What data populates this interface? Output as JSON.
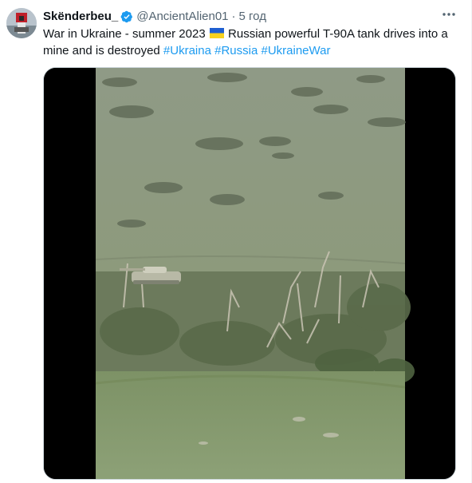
{
  "author": {
    "display_name": "Skënderbeu_",
    "handle": "@AncientAlien01",
    "separator": "·",
    "time": "5 год",
    "verified": true,
    "avatar_icon": "avatar-red-flag-figure"
  },
  "more_icon": "more-horizontal-icon",
  "tweet": {
    "text_before_flag": "War in Ukraine - summer 2023",
    "flag_emoji_icon": "ukraine-flag-icon",
    "text_after_flag": "Russian powerful T-90A tank drives into a mine and is destroyed",
    "hashtags": [
      "#Ukraina",
      "#Russia",
      "#UkraineWar"
    ]
  },
  "media": {
    "type": "video",
    "subject": "drone footage of tank on field edge"
  },
  "colors": {
    "link": "#1d9bf0",
    "verified": "#1d9bf0",
    "secondary_text": "#536471"
  }
}
